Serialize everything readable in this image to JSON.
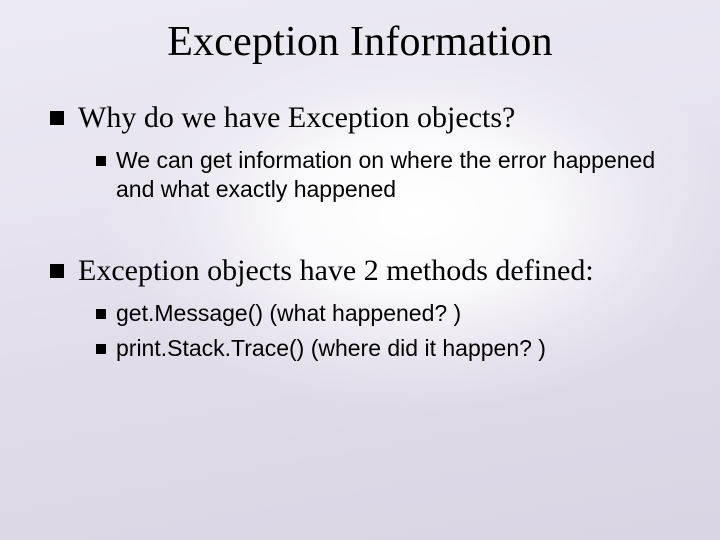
{
  "title": "Exception Information",
  "bullets": {
    "item0": {
      "text": "Why do we have Exception objects?",
      "sub0": "We can get information on where the error happened and what exactly happened"
    },
    "item1": {
      "text": "Exception objects have 2 methods defined:",
      "sub0": "get.Message()  (what happened? )",
      "sub1": "print.Stack.Trace() (where did it happen? )"
    }
  }
}
